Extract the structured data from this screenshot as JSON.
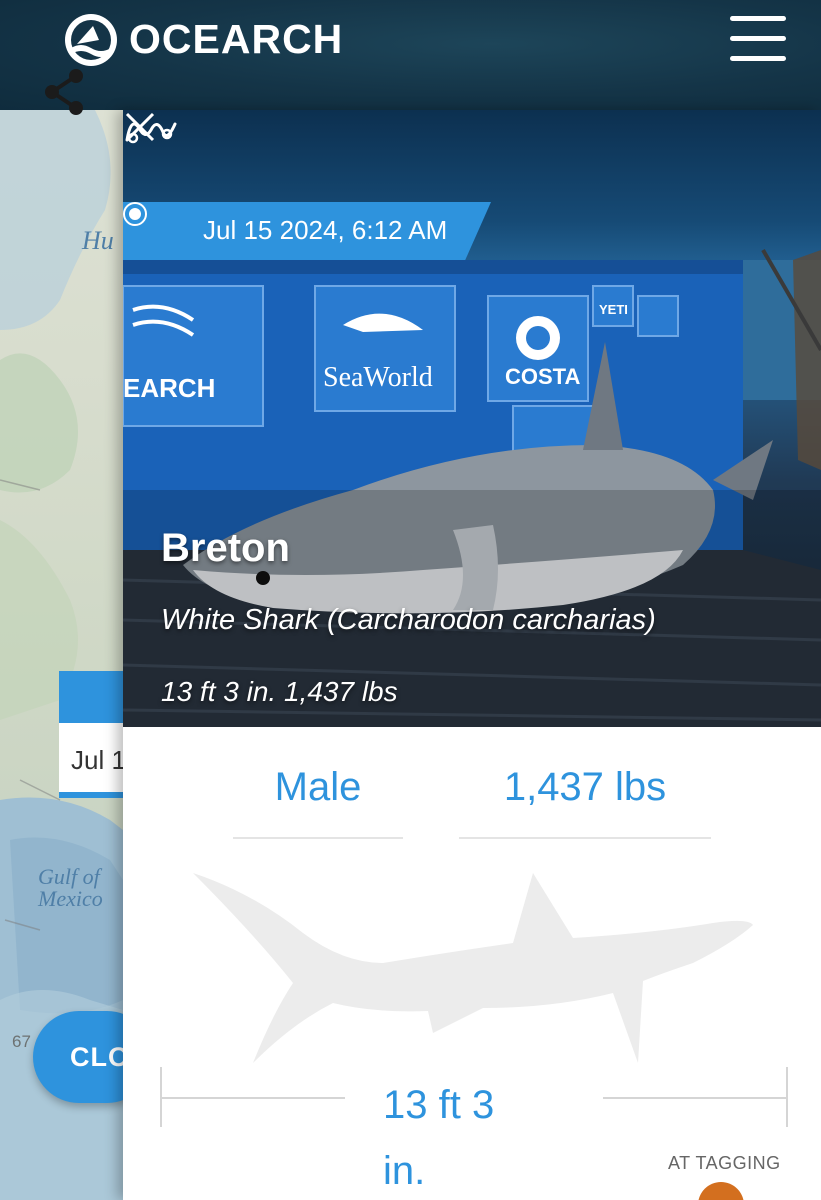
{
  "app": {
    "brand": "OCEARCH"
  },
  "map": {
    "labels": {
      "bay": "Hu",
      "gulf": "Gulf of Mexico"
    },
    "scale_text": "67",
    "date_widget": {
      "value": "Jul 1"
    },
    "close_button_label": "CLO"
  },
  "shark": {
    "ping_date": "Jul 15 2024, 6:12 AM",
    "name": "Breton",
    "species": "White Shark (Carcharodon carcharias)",
    "summary": "13 ft 3 in. 1,437 lbs",
    "sex": "Male",
    "weight": "1,437 lbs",
    "length": "13 ft 3 in.",
    "tagging_label": "AT TAGGING",
    "photo_banner_text": [
      "EARCH",
      "SeaWorld",
      "COSTA",
      "YETI",
      "OCEARCH"
    ]
  },
  "colors": {
    "accent": "#2e93dd",
    "header": "#143447",
    "tag": "#d36f1f"
  },
  "icons": [
    "ocearch-logo-icon",
    "menu-icon",
    "share-icon",
    "close-icon",
    "ping-dot-icon",
    "track-icon"
  ]
}
